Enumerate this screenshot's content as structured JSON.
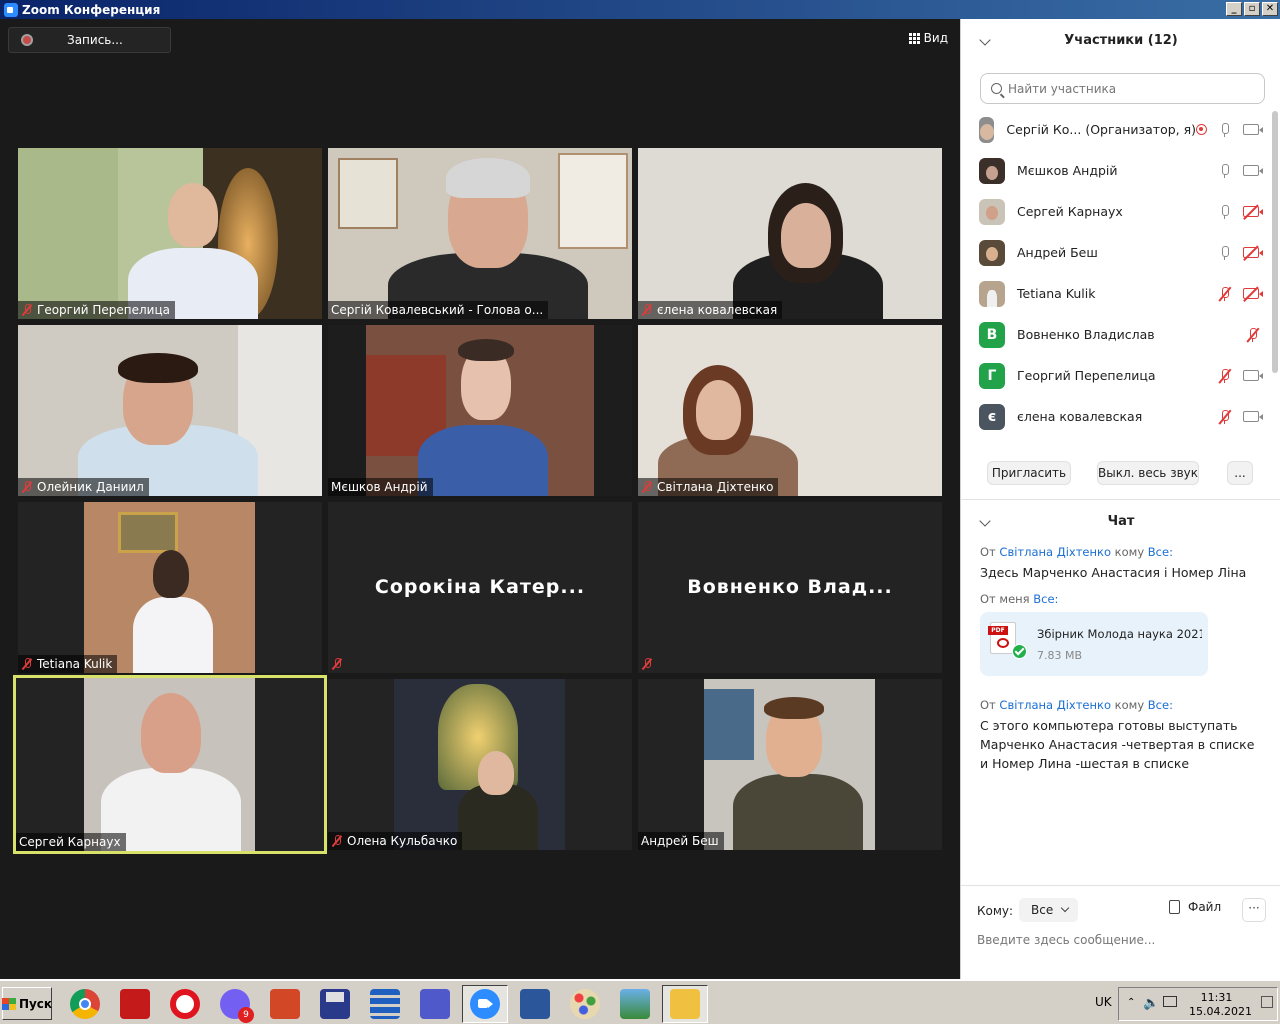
{
  "window": {
    "title": "Zoom Конференция",
    "min": "_",
    "restore": "▫",
    "close": "✕"
  },
  "toolbar": {
    "record_label": "Запись...",
    "view_label": "Вид"
  },
  "tiles": [
    {
      "name": "Георгий Перепелица",
      "muted": true
    },
    {
      "name": "Сергій Ковалевський - Голова о...",
      "muted": false
    },
    {
      "name": "єлена ковалевская",
      "muted": true
    },
    {
      "name": "Олейник Даниил",
      "muted": true
    },
    {
      "name": "Мєшков Андрій",
      "muted": false
    },
    {
      "name": "Світлана Діхтенко",
      "muted": true
    },
    {
      "name": "Tetiana Kulik",
      "muted": true
    },
    {
      "name": "Сорокіна Катер...",
      "muted": true,
      "no_video": true
    },
    {
      "name": "Вовненко Влад...",
      "muted": true,
      "no_video": true
    },
    {
      "name": "Сергей Карнаух",
      "muted": false,
      "active": true
    },
    {
      "name": "Олена Кульбачко",
      "muted": true
    },
    {
      "name": "Андрей Беш",
      "muted": false
    }
  ],
  "participants": {
    "title": "Участники (12)",
    "search_placeholder": "Найти участника",
    "list": [
      {
        "name": "Сергій Ко... (Организатор, я)",
        "mic": "on",
        "cam": "on",
        "recording": true,
        "avatar_color": "#8d8d8d"
      },
      {
        "name": "Мєшков Андрій",
        "mic": "on",
        "cam": "on",
        "avatar_color": "#3b2f2a"
      },
      {
        "name": "Сергей Карнаух",
        "mic": "on",
        "cam": "off",
        "avatar_color": "#c9c3b8"
      },
      {
        "name": "Андрей Беш",
        "mic": "on",
        "cam": "off",
        "avatar_color": "#5a4a3a"
      },
      {
        "name": "Tetiana Kulik",
        "mic": "off",
        "cam": "off",
        "avatar_color": "#b7a48f"
      },
      {
        "name": "Вовненко Владислав",
        "mic": "off",
        "cam": "none",
        "avatar_letter": "В",
        "avatar_color": "#22a34a"
      },
      {
        "name": "Георгий Перепелица",
        "mic": "off",
        "cam": "on",
        "avatar_letter": "Г",
        "avatar_color": "#22a34a"
      },
      {
        "name": "єлена ковалевская",
        "mic": "off",
        "cam": "on",
        "avatar_letter": "є",
        "avatar_color": "#4a5560"
      }
    ],
    "invite_label": "Пригласить",
    "mute_all_label": "Выкл. весь звук",
    "more_label": "..."
  },
  "chat": {
    "title": "Чат",
    "messages": [
      {
        "from_prefix": "От",
        "from": "Світлана Діхтенко",
        "to_prefix": "кому",
        "to": "Все:",
        "text": "Здесь Марченко Анастасия і Номер Ліна"
      },
      {
        "from_prefix": "От меня",
        "to": "Все:",
        "file": {
          "name": "Збірник Молода наука 2021....",
          "size": "7.83 MB",
          "tag": "PDF"
        }
      },
      {
        "from_prefix": "От",
        "from": "Світлана Діхтенко",
        "to_prefix": "кому",
        "to": "Все:",
        "text": "С этого компьютера готовы выступать Марченко Анастасия -четвертая в списке и Номер Лина -шестая в списке"
      }
    ],
    "to_label": "Кому:",
    "to_value": "Все",
    "file_label": "Файл",
    "more_label": "···",
    "input_placeholder": "Введите здесь сообщение..."
  },
  "taskbar": {
    "start_label": "Пуск",
    "viber_badge": "9",
    "lang": "UK",
    "time": "11:31",
    "date": "15.04.2021"
  }
}
